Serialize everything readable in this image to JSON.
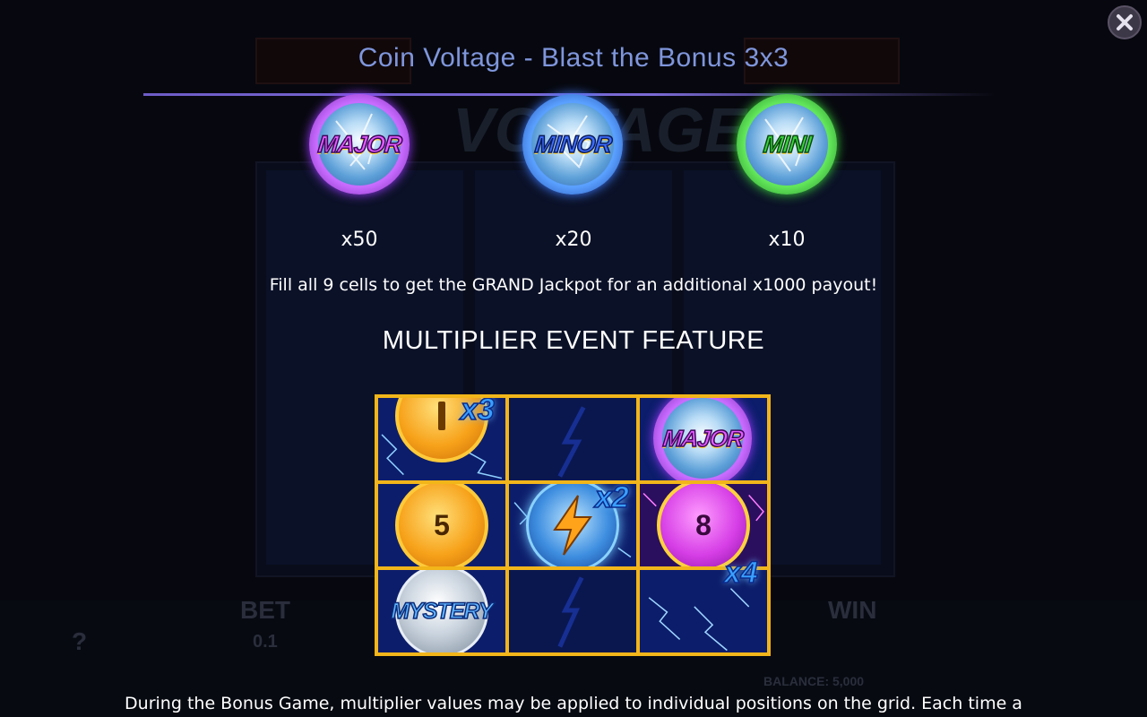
{
  "dialog": {
    "title": "Coin Voltage - Blast the Bonus 3x3",
    "close_icon": "close-icon"
  },
  "jackpot_symbols": [
    {
      "label": "MAJOR",
      "multiplier": "x50",
      "color": "#c86cff"
    },
    {
      "label": "MINOR",
      "multiplier": "x20",
      "color": "#5aa0ff"
    },
    {
      "label": "MINI",
      "multiplier": "x10",
      "color": "#62e65a"
    }
  ],
  "grand_info": "Fill all 9 cells to get the GRAND Jackpot for an additional x1000 payout!",
  "feature_title": "MULTIPLIER EVENT FEATURE",
  "example_grid": {
    "cells": [
      {
        "symbol": "gold-coin",
        "value": "",
        "multiplier": "x3"
      },
      {
        "symbol": "empty",
        "value": "",
        "multiplier": ""
      },
      {
        "symbol": "major-coin",
        "value": "MAJOR",
        "multiplier": ""
      },
      {
        "symbol": "gold-coin",
        "value": "5",
        "multiplier": ""
      },
      {
        "symbol": "bolt-coin",
        "value": "",
        "multiplier": "x2"
      },
      {
        "symbol": "purple-coin",
        "value": "8",
        "multiplier": "x4"
      },
      {
        "symbol": "mystery-coin",
        "value": "MYSTERY",
        "multiplier": ""
      },
      {
        "symbol": "empty",
        "value": "",
        "multiplier": ""
      },
      {
        "symbol": "empty",
        "value": "",
        "multiplier": ""
      }
    ],
    "border_color": "#f2b51a"
  },
  "description": "During the Bonus Game, multiplier values may be applied to individual positions on the grid. Each time a",
  "background": {
    "bet_label": "BET",
    "bet_value": "0.1",
    "win_label": "WIN",
    "balance": "BALANCE: 5,000",
    "help": "?"
  }
}
